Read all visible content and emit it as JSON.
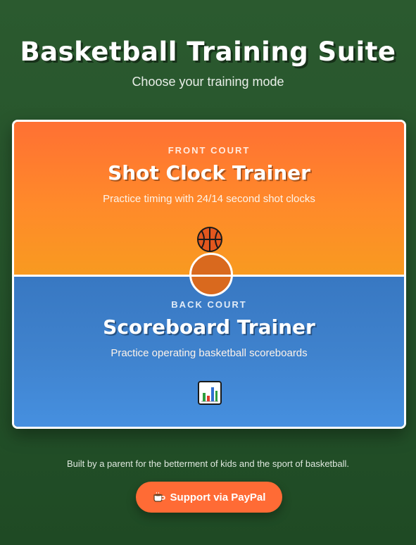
{
  "header": {
    "title": "Basketball Training Suite",
    "subtitle": "Choose your training mode"
  },
  "modes": [
    {
      "kicker": "FRONT COURT",
      "title": "Shot Clock Trainer",
      "description": "Practice timing with 24/14 second shot clocks",
      "icon": "basketball-icon",
      "color": "#ff7033"
    },
    {
      "kicker": "BACK COURT",
      "title": "Scoreboard Trainer",
      "description": "Practice operating basketball scoreboards",
      "icon": "bar-chart-icon",
      "color": "#3f82cd"
    }
  ],
  "footer": {
    "text": "Built by a parent for the betterment of kids and the sport of basketball.",
    "support_label": "Support via PayPal",
    "support_icon": "coffee-icon",
    "support_color": "#ff6b35"
  }
}
